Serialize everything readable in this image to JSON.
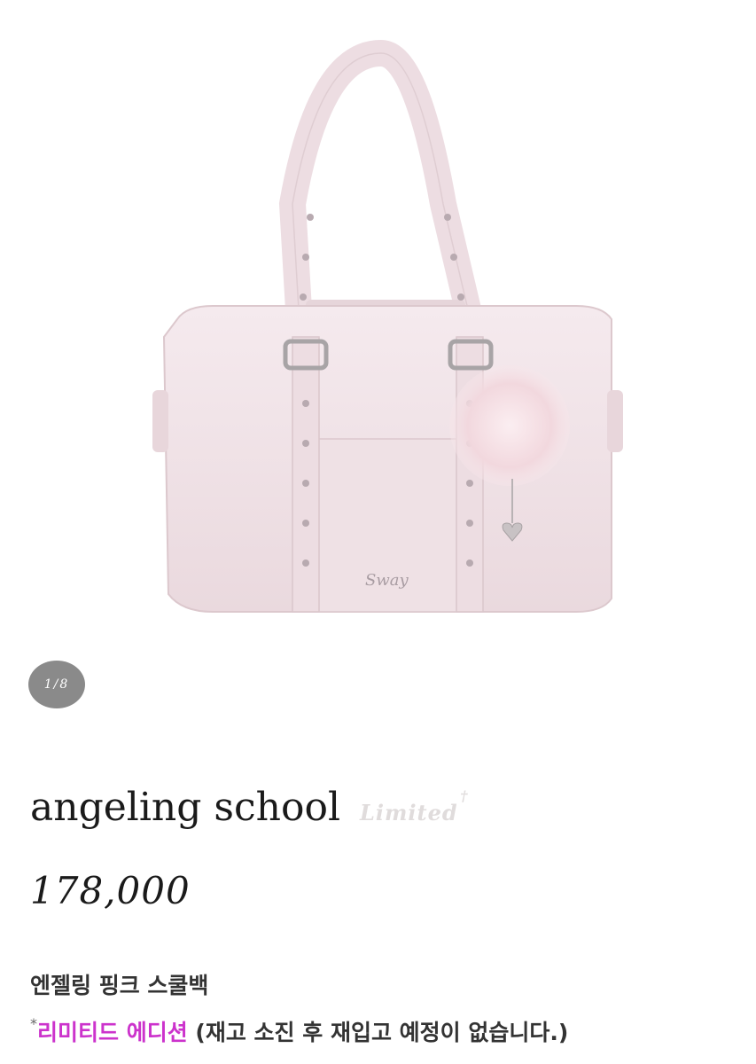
{
  "gallery": {
    "indicator": "1/8"
  },
  "product": {
    "name": "angeling school",
    "badge": "Limited",
    "badge_mark": "†",
    "price": "178,000",
    "subtitle": "엔젤링 핑크 스쿨백",
    "edition_asterisk": "*",
    "edition_label": "리미티드 에디션",
    "edition_note": " (재고 소진 후 재입고 예정이 없습니다.)"
  },
  "colors": {
    "highlight": "#cc33cc",
    "bag_body": "#f1e4e8",
    "indicator_bg": "#8a8a8a"
  }
}
